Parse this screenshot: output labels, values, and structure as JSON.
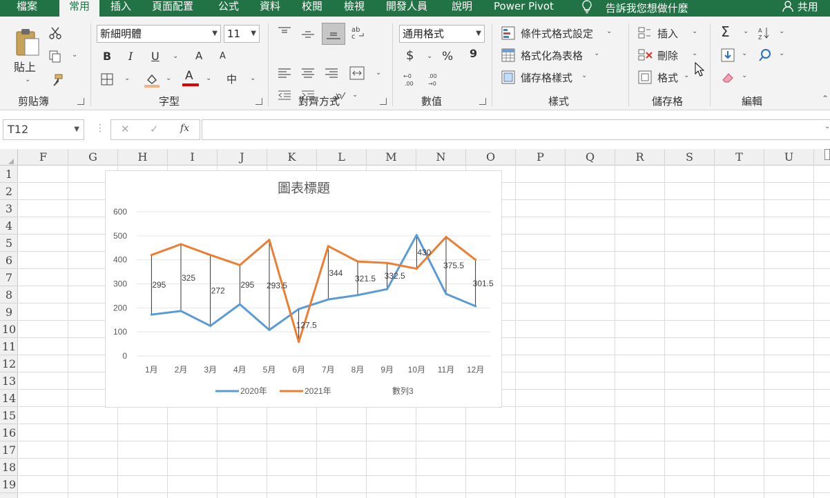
{
  "tabs": [
    {
      "label": "檔案",
      "active": false
    },
    {
      "label": "常用",
      "active": true
    },
    {
      "label": "插入",
      "active": false
    },
    {
      "label": "頁面配置",
      "active": false
    },
    {
      "label": "公式",
      "active": false
    },
    {
      "label": "資料",
      "active": false
    },
    {
      "label": "校閱",
      "active": false
    },
    {
      "label": "檢視",
      "active": false
    },
    {
      "label": "開發人員",
      "active": false
    },
    {
      "label": "說明",
      "active": false
    },
    {
      "label": "Power Pivot",
      "active": false
    }
  ],
  "tell_me": "告訴我您想做什麼",
  "share": "共用",
  "clipboard": {
    "paste_label": "貼上",
    "group_label": "剪貼簿"
  },
  "font": {
    "name": "新細明體",
    "size": "11",
    "group_label": "字型",
    "bold": "B",
    "italic": "I",
    "underline": "U",
    "grow": "A",
    "shrink": "A",
    "color_letter": "A",
    "phonetic": "中"
  },
  "alignment": {
    "group_label": "對齊方式"
  },
  "number": {
    "format": "通用格式",
    "group_label": "數值",
    "currency": "$",
    "percent": "%",
    "comma": "9"
  },
  "styles": {
    "conditional": "條件式格式設定",
    "as_table": "格式化為表格",
    "cell_styles": "儲存格樣式",
    "group_label": "樣式"
  },
  "cells": {
    "insert": "插入",
    "delete": "刪除",
    "format": "格式",
    "group_label": "儲存格"
  },
  "editing": {
    "group_label": "編輯"
  },
  "formula_bar": {
    "name_box": "T12",
    "cancel": "✕",
    "enter": "✓",
    "fx": "fx",
    "formula": ""
  },
  "columns": [
    "F",
    "G",
    "H",
    "I",
    "J",
    "K",
    "L",
    "M",
    "N",
    "O",
    "P",
    "Q",
    "R",
    "S",
    "T",
    "U"
  ],
  "rows": [
    "1",
    "2",
    "3",
    "4",
    "5",
    "6",
    "7",
    "8",
    "9",
    "10",
    "11",
    "12",
    "13",
    "14",
    "15",
    "16",
    "17",
    "18",
    "19"
  ],
  "colors": {
    "ribbon_green": "#217346",
    "series_2020": "#5b9bd5",
    "series_2021": "#ed7d31"
  },
  "chart_data": {
    "type": "line",
    "title": "圖表標題",
    "categories": [
      "1月",
      "2月",
      "3月",
      "4月",
      "5月",
      "6月",
      "7月",
      "8月",
      "9月",
      "10月",
      "11月",
      "12月"
    ],
    "ylim": [
      0,
      600
    ],
    "yticks": [
      0,
      100,
      200,
      300,
      400,
      500,
      600
    ],
    "grid": true,
    "legend": "bottom",
    "series": [
      {
        "name": "2020年",
        "color": "#5b9bd5",
        "values": [
          172,
          187,
          125,
          215,
          108,
          195,
          235,
          253,
          278,
          503,
          258,
          207
        ]
      },
      {
        "name": "2021年",
        "color": "#ed7d31",
        "values": [
          420,
          465,
          420,
          378,
          483,
          58,
          457,
          393,
          387,
          363,
          495,
          400
        ]
      },
      {
        "name": "數列3",
        "color": "none",
        "values": [
          295,
          325,
          272,
          295,
          293.5,
          127.5,
          344,
          321.5,
          332.5,
          430,
          375.5,
          301.5
        ]
      }
    ],
    "data_labels": [
      "295",
      "325",
      "272",
      "295",
      "293.5",
      "127.5",
      "344",
      "321.5",
      "332.5",
      "430",
      "375.5",
      "301.5"
    ],
    "high_low_lines": true
  }
}
